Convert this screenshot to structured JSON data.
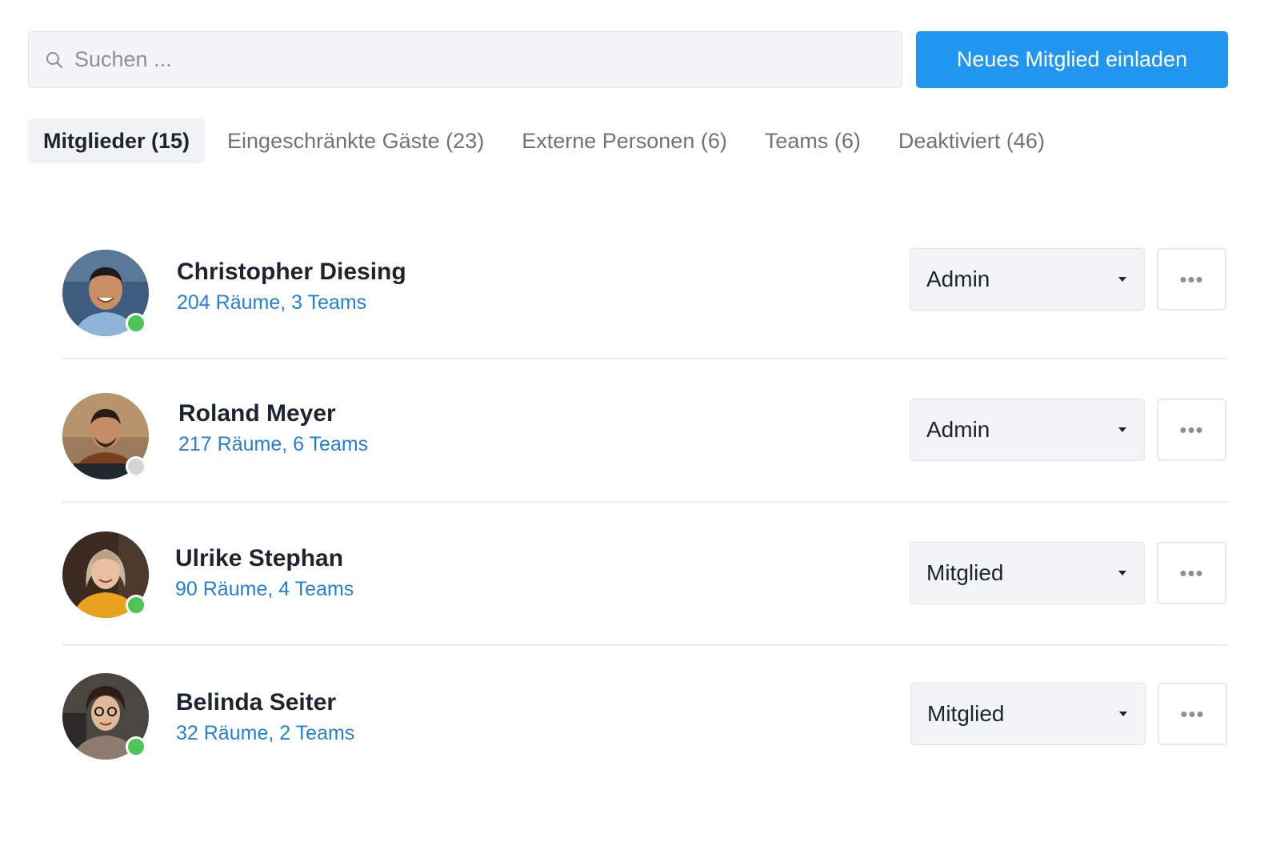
{
  "search": {
    "placeholder": "Suchen ..."
  },
  "header": {
    "invite_label": "Neues Mitglied einladen"
  },
  "tabs": [
    {
      "label": "Mitglieder (15)",
      "active": true
    },
    {
      "label": "Eingeschränkte Gäste (23)",
      "active": false
    },
    {
      "label": "Externe Personen (6)",
      "active": false
    },
    {
      "label": "Teams (6)",
      "active": false
    },
    {
      "label": "Deaktiviert (46)",
      "active": false
    }
  ],
  "members": [
    {
      "name": "Christopher Diesing",
      "rooms": "204 Räume",
      "teams": "3 Teams",
      "separator": ",",
      "role": "Admin",
      "status": "online",
      "more_label": "•••"
    },
    {
      "name": "Roland Meyer",
      "rooms": "217 Räume",
      "teams": "6 Teams",
      "separator": ",",
      "role": "Admin",
      "status": "offline",
      "more_label": "•••"
    },
    {
      "name": "Ulrike Stephan",
      "rooms": "90 Räume",
      "teams": "4 Teams",
      "separator": ",",
      "role": "Mitglied",
      "status": "online",
      "more_label": "•••"
    },
    {
      "name": "Belinda Seiter",
      "rooms": "32 Räume",
      "teams": "2 Teams",
      "separator": ",",
      "role": "Mitglied",
      "status": "online",
      "more_label": "•••"
    }
  ],
  "colors": {
    "accent": "#2196f0",
    "link": "#2480d6",
    "online": "#4cc556",
    "offline": "#d2d4d8"
  },
  "icons": {
    "search": "search-icon",
    "more": "more-icon",
    "dropdown": "chevron-down-icon",
    "status": "status-dot-icon"
  }
}
